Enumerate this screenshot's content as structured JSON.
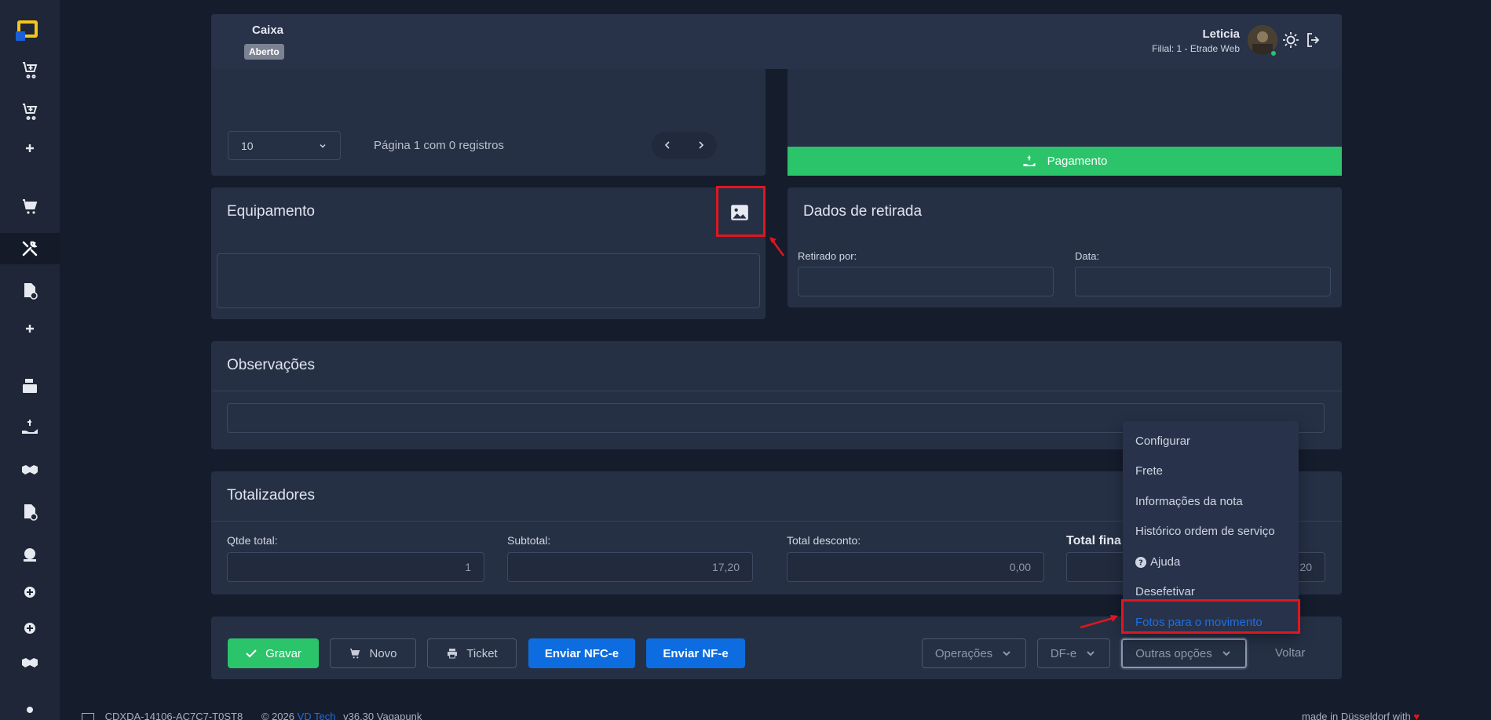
{
  "header": {
    "caixa_label": "Caixa",
    "caixa_status": "Aberto",
    "user_name": "Leticia",
    "filial": "Filial: 1 - Etrade Web"
  },
  "pagination": {
    "page_size": "10",
    "info": "Página 1 com 0 registros"
  },
  "payment": {
    "button_label": "Pagamento",
    "color": "#2bc46a"
  },
  "equipamento": {
    "title": "Equipamento"
  },
  "retirada": {
    "title": "Dados de retirada",
    "retirado_label": "Retirado por:",
    "data_label": "Data:"
  },
  "observacoes": {
    "title": "Observações"
  },
  "totalizadores": {
    "title": "Totalizadores",
    "qtde_label": "Qtde total:",
    "qtde_value": "1",
    "subtotal_label": "Subtotal:",
    "subtotal_value": "17,20",
    "desconto_label": "Total desconto:",
    "desconto_value": "0,00",
    "final_label": "Total fina",
    "final_value": "20"
  },
  "footer_buttons": {
    "gravar": "Gravar",
    "novo": "Novo",
    "ticket": "Ticket",
    "enviar_nfce": "Enviar NFC-e",
    "enviar_nfe": "Enviar NF-e",
    "operacoes": "Operações",
    "dfe": "DF-e",
    "outras": "Outras opções",
    "voltar": "Voltar"
  },
  "menu": {
    "items": [
      "Configurar",
      "Frete",
      "Informações da nota",
      "Histórico ordem de serviço",
      "Ajuda",
      "Desefetivar",
      "Fotos para o movimento"
    ],
    "highlight_color": "#1f6fe0"
  },
  "page_footer": {
    "left": "CDXDA-14106-AC7C7-T0ST8",
    "copyright": "© 2026",
    "brand": "VD Tech",
    "version": "v36.30 Vagapunk",
    "right": "made in Düsseldorf with"
  }
}
